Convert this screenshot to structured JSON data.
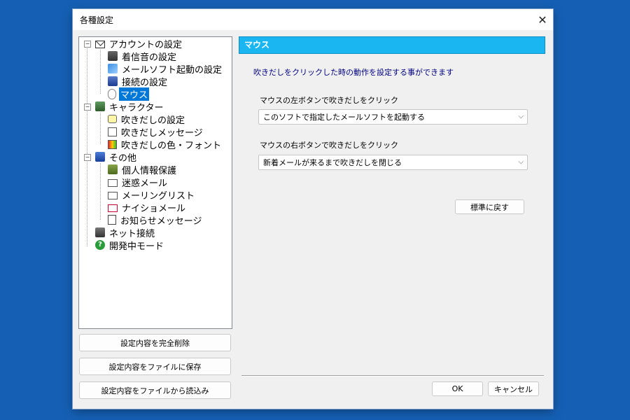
{
  "window": {
    "title": "各種設定",
    "close_glyph": "✕"
  },
  "tree": {
    "items": [
      {
        "label": "アカウントの設定",
        "icon": "mail-account-icon"
      },
      {
        "label": "着信音の設定",
        "icon": "bell-icon"
      },
      {
        "label": "メールソフト起動の設定",
        "icon": "launch-icon"
      },
      {
        "label": "接続の設定",
        "icon": "connection-icon"
      },
      {
        "label": "マウス",
        "icon": "mouse-icon",
        "selected": true
      },
      {
        "label": "キャラクター",
        "icon": "character-icon"
      },
      {
        "label": "吹きだしの設定",
        "icon": "balloon-icon"
      },
      {
        "label": "吹きだしメッセージ",
        "icon": "message-icon"
      },
      {
        "label": "吹きだしの色・フォント",
        "icon": "color-font-icon"
      },
      {
        "label": "その他",
        "icon": "other-icon"
      },
      {
        "label": "個人情報保護",
        "icon": "privacy-icon"
      },
      {
        "label": "迷惑メール",
        "icon": "spam-mail-icon"
      },
      {
        "label": "メーリングリスト",
        "icon": "mailing-list-icon"
      },
      {
        "label": "ナイショメール",
        "icon": "secret-mail-icon"
      },
      {
        "label": "お知らせメッセージ",
        "icon": "notice-icon"
      },
      {
        "label": "ネット接続",
        "icon": "network-icon"
      },
      {
        "label": "開発中モード",
        "icon": "help-icon"
      }
    ]
  },
  "left_buttons": {
    "delete_all": "設定内容を完全削除",
    "save_file": "設定内容をファイルに保存",
    "load_file": "設定内容をファイルから読込み"
  },
  "panel": {
    "header": "マウス",
    "description": "吹きだしをクリックした時の動作を設定する事ができます",
    "left_click_label": "マウスの左ボタンで吹きだしをクリック",
    "left_click_value": "このソフトで指定したメールソフトを起動する",
    "right_click_label": "マウスの右ボタンで吹きだしをクリック",
    "right_click_value": "新着メールが来るまで吹きだしを閉じる",
    "reset_button": "標準に戻す",
    "caret": "⌵"
  },
  "footer": {
    "ok": "OK",
    "cancel": "キャンセル"
  },
  "colors": {
    "background": "#1560b5",
    "header_bar": "#19b6f2",
    "selection": "#0078d7",
    "description_text": "#00007f"
  }
}
